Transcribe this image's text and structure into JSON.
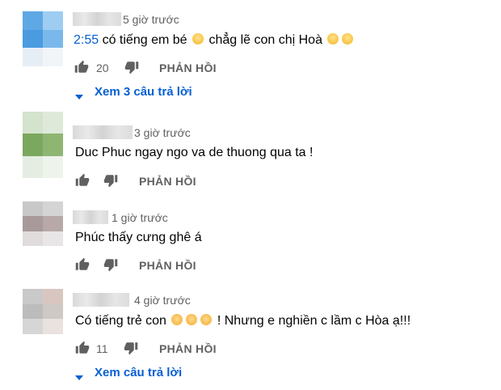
{
  "comments": [
    {
      "time": "5 giờ trước",
      "text": {
        "timestamp": "2:55",
        "body": " có tiếng em bé",
        "body2": " chẳg lẽ con chị Hoà"
      },
      "likes": "20",
      "reply_label": "PHẢN HỒI",
      "view_replies": "Xem 3 câu trả lời",
      "avatar_colors": [
        "#5fa8e6",
        "#9fcdf2",
        "#4a9be0",
        "#7ab8ec",
        "#e6eef5",
        "#f2f5f8"
      ]
    },
    {
      "time": "3 giờ trước",
      "text": {
        "body": "Duc Phuc ngay ngo va de thuong  qua ta !"
      },
      "likes": "",
      "reply_label": "PHẢN HỒI",
      "avatar_colors": [
        "#d3e3cc",
        "#dfe9d9",
        "#7ba85f",
        "#8eb672",
        "#e5ede2",
        "#eef3ec"
      ]
    },
    {
      "time": "1 giờ trước",
      "text": {
        "body": "Phúc thấy cưng ghê á"
      },
      "likes": "",
      "reply_label": "PHẢN HỒI",
      "avatar_colors": [
        "#c8c8c8",
        "#d4d4d4",
        "#a89a9a",
        "#b8a8a8",
        "#e0dcdc",
        "#e8e6e6"
      ]
    },
    {
      "time": "4 giờ trước",
      "text": {
        "body": "Có tiếng trẻ con",
        "body2": " !  Nhưng e nghiền c lầm c Hòa ạ!!!"
      },
      "likes": "11",
      "reply_label": "PHẢN HỒI",
      "view_replies": "Xem câu trả lời",
      "avatar_colors": [
        "#c9c9c9",
        "#d9c6c0",
        "#bcbcbc",
        "#cfc9c6",
        "#d6d6d6",
        "#e9e2de"
      ]
    }
  ],
  "icons": {
    "like": "thumb-up-icon",
    "dislike": "thumb-down-icon",
    "expand": "caret-down-icon",
    "emoji": "smiley-emoji",
    "baby": "baby-emoji"
  },
  "colors": {
    "link": "#065fd4",
    "meta": "#606060",
    "text": "#030303"
  }
}
